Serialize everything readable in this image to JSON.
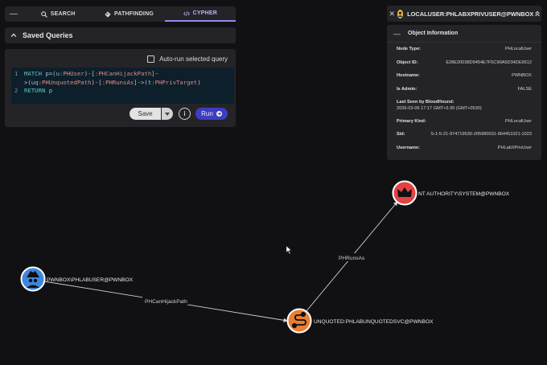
{
  "tabs": [
    {
      "label": "SEARCH",
      "icon": "search-icon"
    },
    {
      "label": "PATHFINDING",
      "icon": "pathfinding-icon"
    },
    {
      "label": "CYPHER",
      "icon": "code-icon",
      "active": true
    }
  ],
  "saved_queries": {
    "title": "Saved Queries"
  },
  "editor": {
    "auto_run_label": "Auto-run selected query",
    "lines": [
      {
        "n": "1",
        "tokens": [
          {
            "t": "MATCH ",
            "c": "kw"
          },
          {
            "t": "p",
            "c": "var"
          },
          {
            "t": "=(",
            "c": "op"
          },
          {
            "t": "u",
            "c": "var"
          },
          {
            "t": ":PHUser",
            "c": "lbl"
          },
          {
            "t": ")-[",
            "c": "op"
          },
          {
            "t": ":PHCanHijackPath",
            "c": "lbl"
          },
          {
            "t": "]-",
            "c": "op"
          }
        ]
      },
      {
        "n": "",
        "tokens": [
          {
            "t": ">(",
            "c": "op"
          },
          {
            "t": "uq",
            "c": "var"
          },
          {
            "t": ":PHUnquotedPath",
            "c": "lbl"
          },
          {
            "t": ")-[",
            "c": "op"
          },
          {
            "t": ":PHRunsAs",
            "c": "lbl"
          },
          {
            "t": "]->(",
            "c": "op"
          },
          {
            "t": "t",
            "c": "var"
          },
          {
            "t": ":PHPrivTarget",
            "c": "lbl"
          },
          {
            "t": ")",
            "c": "op"
          }
        ]
      },
      {
        "n": "2",
        "tokens": [
          {
            "t": "RETURN ",
            "c": "kw"
          },
          {
            "t": "p",
            "c": "var"
          }
        ]
      }
    ],
    "save_label": "Save",
    "info_label": "i",
    "run_label": "Run"
  },
  "object_panel": {
    "title": "LOCALUSER:PHLABXPRIVUSER@PWNBOX",
    "section": "Object Information",
    "props": [
      {
        "key": "Node Type:",
        "value": "PHLocalUser"
      },
      {
        "key": "Object ID:",
        "value": "E28E20038D9454E7F5C90A5D34DE9512"
      },
      {
        "key": "Hostname:",
        "value": "PWNBOX"
      },
      {
        "key": "Is Admin:",
        "value": "FALSE"
      },
      {
        "key": "Last Seen by BloodHound:",
        "value": "2026-03-06 17:17 GMT+5:30 (GMT+0530)",
        "stack": true
      },
      {
        "key": "Primary Kind:",
        "value": "PHLocalUser"
      },
      {
        "key": "Sid:",
        "value": "S-1-5-21-974719530-205980031-964451021-1023"
      },
      {
        "key": "Username:",
        "value": "PHLabXPrivUser"
      }
    ]
  },
  "graph": {
    "nodes": [
      {
        "id": "user",
        "label": "PWNBOX\\PHLABUSER@PWNBOX",
        "color": "#3f86dd",
        "icon": "spy-icon"
      },
      {
        "id": "svc",
        "label": "UNQUOTED:PHLABUNQUOTEDSVC@PWNBOX",
        "color": "#ea7d30",
        "icon": "route-icon"
      },
      {
        "id": "target",
        "label": "NT AUTHORITY\\SYSTEM@PWNBOX",
        "color": "#e24242",
        "icon": "crown-icon"
      }
    ],
    "edges": [
      {
        "label": "PHCanHijackPath"
      },
      {
        "label": "PHRunsAs"
      }
    ]
  }
}
